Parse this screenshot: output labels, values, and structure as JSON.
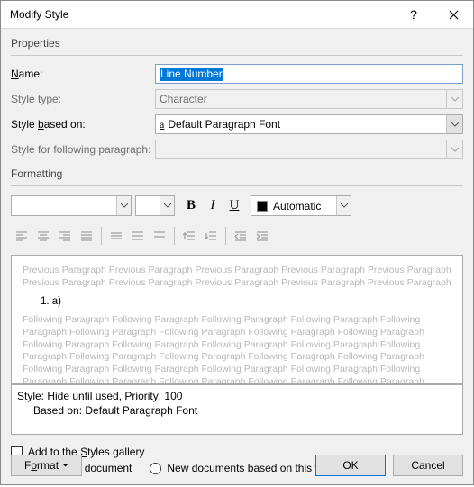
{
  "titlebar": {
    "title": "Modify Style"
  },
  "properties": {
    "section": "Properties",
    "name_label": "Name:",
    "name_value": "Line Number",
    "styletype_label": "Style type:",
    "styletype_value": "Character",
    "basedon_label": "Style based on:",
    "basedon_value": "Default Paragraph Font",
    "following_label": "Style for following paragraph:",
    "following_value": ""
  },
  "formatting": {
    "section": "Formatting",
    "auto_label": "Automatic"
  },
  "preview": {
    "prev_text": "Previous Paragraph Previous Paragraph Previous Paragraph Previous Paragraph Previous Paragraph Previous Paragraph Previous Paragraph Previous Paragraph Previous Paragraph Previous Paragraph",
    "sample": "1.        a)",
    "foll_text": "Following Paragraph Following Paragraph Following Paragraph Following Paragraph Following Paragraph Following Paragraph Following Paragraph Following Paragraph Following Paragraph Following Paragraph Following Paragraph Following Paragraph Following Paragraph Following Paragraph Following Paragraph Following Paragraph Following Paragraph Following Paragraph Following Paragraph Following Paragraph Following Paragraph Following Paragraph Following Paragraph Following Paragraph Following Paragraph Following Paragraph Following Paragraph Following Paragraph Following Paragraph Following Paragraph Following Paragraph Following Paragraph Following Paragraph Following Paragraph Following Paragraph"
  },
  "stylebox": {
    "line1": "Style: Hide until used, Priority: 100",
    "line2": "Based on: Default Paragraph Font"
  },
  "options": {
    "add_gallery": "Add to the Styles gallery",
    "only_doc": "Only in this document",
    "new_template": "New documents based on this template"
  },
  "buttons": {
    "format": "Format",
    "ok": "OK",
    "cancel": "Cancel"
  }
}
